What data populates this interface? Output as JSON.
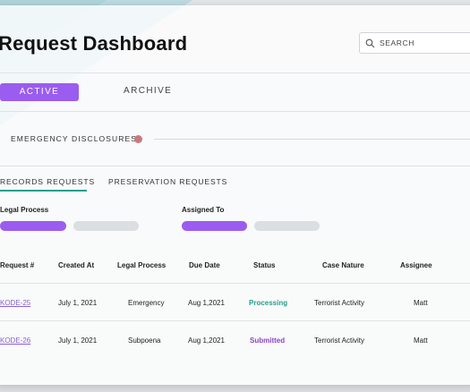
{
  "page": {
    "title": "Request Dashboard",
    "search": {
      "placeholder": "SEARCH",
      "icon": "search-icon"
    }
  },
  "tabs": [
    {
      "label": "ACTIVE",
      "active": true
    },
    {
      "label": "ARCHIVE",
      "active": false
    }
  ],
  "section": {
    "label": "EMERGENCY DISCLOSURES",
    "indicator_color": "#c9787e"
  },
  "subtabs": [
    {
      "label": "RECORDS REQUESTS",
      "active": true
    },
    {
      "label": "PRESERVATION REQUESTS",
      "active": false
    }
  ],
  "filters": [
    {
      "label": "Legal Process"
    },
    {
      "label": "Assigned To"
    }
  ],
  "table": {
    "columns": [
      "Request #",
      "Created At",
      "Legal Process",
      "Due Date",
      "Status",
      "Case Nature",
      "Assignee"
    ],
    "rows": [
      {
        "request": "KODE-25",
        "created": "July 1, 2021",
        "legal_process": "Emergency",
        "due": "Aug 1,2021",
        "status": "Processing",
        "status_color": "#2a9d8f",
        "case_nature": "Terrorist Activity",
        "assignee": "Matt"
      },
      {
        "request": "KODE-26",
        "created": "July 1, 2021",
        "legal_process": "Subpoena",
        "due": "Aug 1,2021",
        "status": "Submitted",
        "status_color": "#8e44c9",
        "case_nature": "Terrorist Activity",
        "assignee": "Matt"
      }
    ]
  },
  "colors": {
    "accent": "#9b5cf0",
    "teal": "#2a9d8f",
    "pill_inactive": "#dcdfe1"
  }
}
